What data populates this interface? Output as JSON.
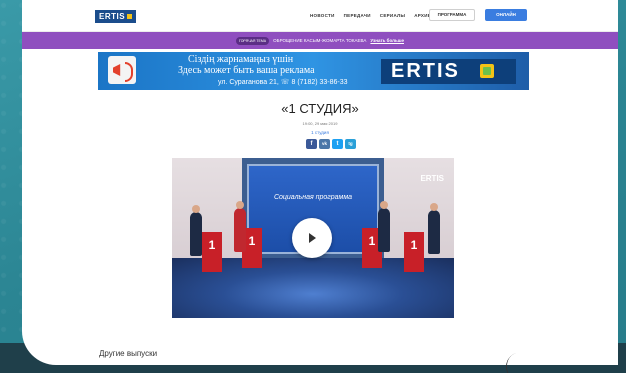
{
  "header": {
    "logo": "ERTIS",
    "nav": [
      "НОВОСТИ",
      "ПЕРЕДАЧИ",
      "СЕРИАЛЫ",
      "АРХИВ"
    ],
    "schedule_label": "ПРОГРАММА",
    "live_label": "ОНЛАЙН"
  },
  "announcement": {
    "tag": "ГОРЯЧАЯ ТЕМА",
    "text": "ОБРОЩЕНИЕ КАСЫМ-ЖОМАРТА ТОКАЕВА",
    "more": "Узнать больше"
  },
  "ad": {
    "line1": "Сіздің жарнамаңыз үшін",
    "line2": "Здесь может быть ваша реклама",
    "line3": "ул. Сураганова 21,  ☏ 8 (7182) 33-86-33",
    "brand": "ERTIS"
  },
  "article": {
    "title": "«1 СТУДИЯ»",
    "date": "19:00, 29 мая 2019",
    "category": "1 студия",
    "share": [
      "f",
      "vk",
      "t",
      "tg"
    ]
  },
  "video": {
    "screen_text": "Социальная программа",
    "tv_logo": "ERTIS"
  },
  "other_label": "Другие выпуски",
  "colors": {
    "announce_bg": "#8f4fbf",
    "live_button": "#3a7de0",
    "brand_blue": "#0d3f7a",
    "facebook": "#3b5998",
    "vk": "#4a76a8",
    "twitter": "#1da1f2",
    "telegram": "#2aa0d8"
  }
}
